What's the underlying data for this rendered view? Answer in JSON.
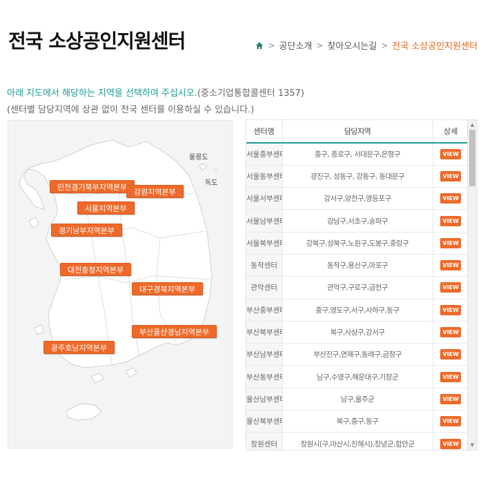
{
  "page": {
    "title": "전국 소상공인지원센터"
  },
  "breadcrumb": {
    "home_icon": "home-icon",
    "items": [
      "공단소개",
      "찾아오시는길",
      "전국 소상공인지원센터"
    ],
    "separator": ">",
    "current_color": "#e8641b"
  },
  "intro": {
    "line1": "아래 지도에서 해당하는 지역을 선택하여 주십시오.",
    "line1_phone": "(중소기업통합콜센터 1357)",
    "line2": "(센터별 담당지역에 상관 없이 전국 센터를 이용하실 수 있습니다.)",
    "accent_color": "#1a9a92"
  },
  "map": {
    "islands": [
      "울릉도",
      "독도"
    ],
    "regions": [
      "인천경기북부지역본부",
      "강원지역본부",
      "서울지역본부",
      "경기남부지역본부",
      "대전충청지역본부",
      "대구경북지역본부",
      "부산울산경남지역본부",
      "광주호남지역본부"
    ],
    "button_color": "#ee6a2a"
  },
  "table": {
    "headers": [
      "센터명",
      "담당지역",
      "상세"
    ],
    "view_label": "VIEW",
    "rows": [
      {
        "name": "서울중부센터",
        "area": "중구, 종로구, 서대문구,은평구"
      },
      {
        "name": "서울동부센터",
        "area": "광진구, 성동구, 강동구, 동대문구"
      },
      {
        "name": "서울서부센터",
        "area": "강서구,양천구,영등포구"
      },
      {
        "name": "서울남부센터",
        "area": "강남구,서초구,송파구"
      },
      {
        "name": "서울북부센터",
        "area": "강북구,성북구,노원구,도봉구,중랑구"
      },
      {
        "name": "동작센터",
        "area": "동작구,용산구,마포구"
      },
      {
        "name": "관악센터",
        "area": "관악구,구로구,금천구"
      },
      {
        "name": "부산중부센터",
        "area": "중구,영도구,서구,사하구,동구"
      },
      {
        "name": "부산북부센터",
        "area": "북구,사상구,강서구"
      },
      {
        "name": "부산남부센터",
        "area": "부산진구,연제구,동래구,금정구"
      },
      {
        "name": "부산동부센터",
        "area": "남구,수영구,해운대구,기장군"
      },
      {
        "name": "울산남부센터",
        "area": "남구,울주군"
      },
      {
        "name": "울산북부센터",
        "area": "북구,중구,동구"
      },
      {
        "name": "창원센터",
        "area": "창원시(구,마산시,진해시),창녕군,함안군"
      }
    ]
  }
}
